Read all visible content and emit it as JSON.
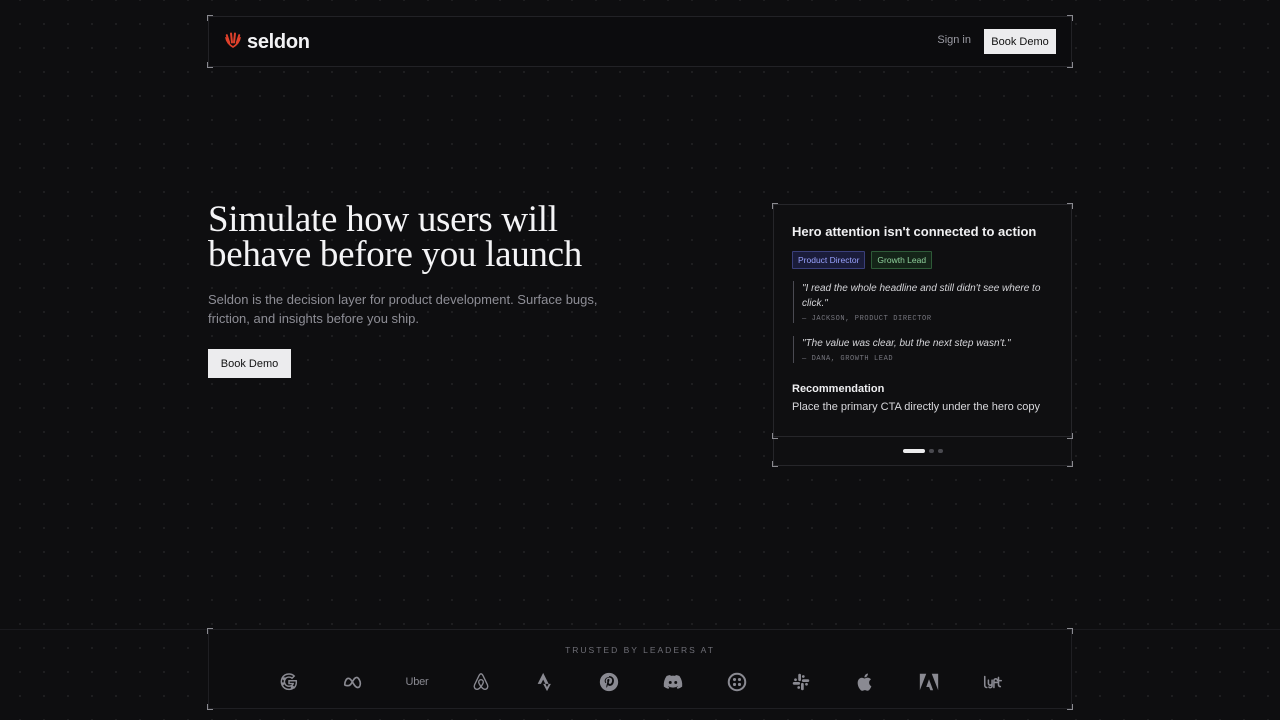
{
  "header": {
    "logo_text": "seldon",
    "signin_label": "Sign in",
    "book_demo_label": "Book Demo"
  },
  "hero": {
    "title": "Simulate how users will behave before you launch",
    "subtitle": "Seldon is the decision layer for product development. Surface bugs, friction, and insights before you ship.",
    "cta_label": "Book Demo"
  },
  "card": {
    "title": "Hero attention isn't connected to action",
    "tags": [
      "Product Director",
      "Growth Lead"
    ],
    "quotes": [
      {
        "text": "\"I read the whole headline and still didn't see where to click.\"",
        "author": "— JACKSON, PRODUCT DIRECTOR"
      },
      {
        "text": "\"The value was clear, but the next step wasn't.\"",
        "author": "— DANA, GROWTH LEAD"
      }
    ],
    "recommendation_title": "Recommendation",
    "recommendation_text": "Place the primary CTA directly under the hero copy",
    "carousel_active_index": 0,
    "carousel_count": 3
  },
  "trusted": {
    "label": "TRUSTED BY LEADERS AT",
    "logos": [
      "google-icon",
      "meta-icon",
      "uber",
      "airbnb-icon",
      "strava-icon",
      "pinterest-icon",
      "discord-icon",
      "twilio-icon",
      "slack-icon",
      "apple-icon",
      "adobe-icon",
      "lyft-icon"
    ],
    "uber_word": "Uber"
  },
  "colors": {
    "background": "#0e0e10",
    "accent_logo": "#e0412b",
    "button_light": "#ececee",
    "tag_product_director": "#9aa3ff",
    "tag_growth_lead": "#8fd19c"
  }
}
